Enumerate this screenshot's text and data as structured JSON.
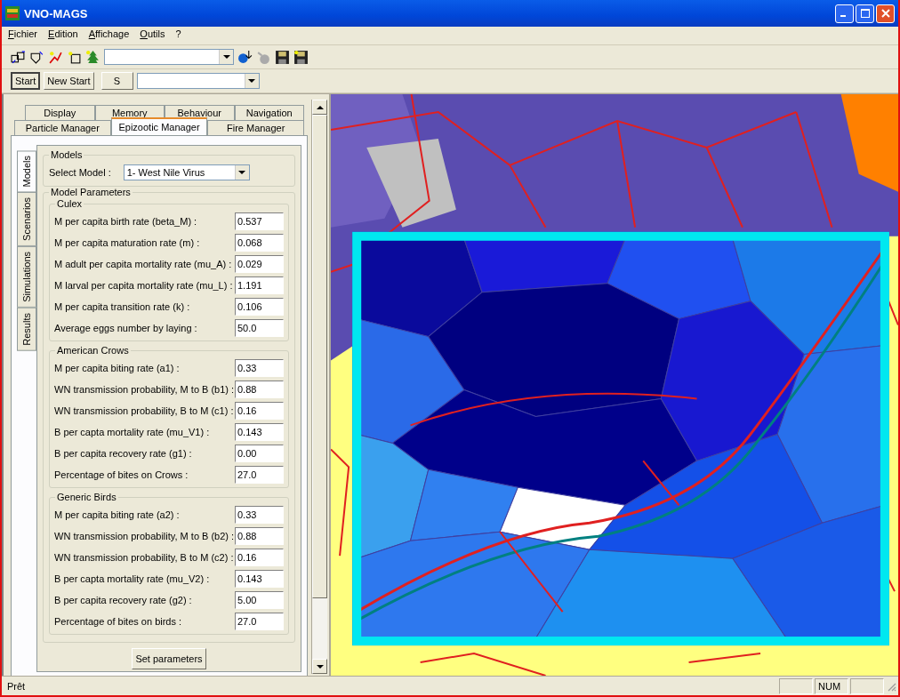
{
  "window": {
    "title": "VNO-MAGS"
  },
  "menu": [
    "Fichier",
    "Edition",
    "Affichage",
    "Outils",
    "?"
  ],
  "run_bar": {
    "buttons": [
      {
        "label": "Start",
        "pressed": true
      },
      {
        "label": "New Start",
        "pressed": false
      },
      {
        "label": "S",
        "pressed": false
      }
    ]
  },
  "top_tabs": [
    [
      {
        "label": "Display",
        "selected": false
      },
      {
        "label": "Memory",
        "selected": false
      },
      {
        "label": "Behaviour",
        "selected": false
      },
      {
        "label": "Navigation",
        "selected": false
      }
    ],
    [
      {
        "label": "Particle Manager",
        "selected": false
      },
      {
        "label": "Epizootic Manager",
        "selected": true
      },
      {
        "label": "Fire Manager",
        "selected": false
      }
    ]
  ],
  "side_tabs": [
    {
      "label": "Models",
      "selected": true
    },
    {
      "label": "Scenarios",
      "selected": false
    },
    {
      "label": "Simulations",
      "selected": false
    },
    {
      "label": "Results",
      "selected": false
    }
  ],
  "models": {
    "title": "Models",
    "select_label": "Select Model :",
    "select_value": "1- West Nile Virus"
  },
  "parameters": {
    "title": "Model Parameters",
    "groups": [
      {
        "title": "Culex",
        "rows": [
          {
            "label": "M per capita birth rate (beta_M) :",
            "value": "0.537"
          },
          {
            "label": "M per capita maturation rate (m) :",
            "value": "0.068"
          },
          {
            "label": "M adult per capita mortality rate (mu_A) :",
            "value": "0.029"
          },
          {
            "label": "M larval per capita mortality rate (mu_L) :",
            "value": "1.191"
          },
          {
            "label": "M per capita transition rate (k) :",
            "value": "0.106"
          },
          {
            "label": "Average eggs number by laying :",
            "value": "50.0"
          }
        ]
      },
      {
        "title": "American Crows",
        "rows": [
          {
            "label": "M per capita biting rate (a1) :",
            "value": "0.33"
          },
          {
            "label": "WN transmission probability, M to B (b1) :",
            "value": "0.88"
          },
          {
            "label": "WN transmission probability, B to M (c1) :",
            "value": "0.16"
          },
          {
            "label": "B per capta mortality rate (mu_V1) :",
            "value": "0.143"
          },
          {
            "label": "B per capita recovery rate (g1) :",
            "value": "0.00"
          },
          {
            "label": "Percentage of bites on Crows :",
            "value": "27.0"
          }
        ]
      },
      {
        "title": "Generic Birds",
        "rows": [
          {
            "label": "M per capita biting rate (a2) :",
            "value": "0.33"
          },
          {
            "label": "WN transmission probability, M to B (b2) :",
            "value": "0.88"
          },
          {
            "label": "WN transmission probability, B to M (c2) :",
            "value": "0.16"
          },
          {
            "label": "B per capta mortality rate (mu_V2) :",
            "value": "0.143"
          },
          {
            "label": "B per capita recovery rate (g2) :",
            "value": "5.00"
          },
          {
            "label": "Percentage of bites on birds :",
            "value": "27.0"
          }
        ]
      }
    ],
    "button": "Set parameters"
  },
  "status_bar": {
    "text": "Prêt",
    "indicators": [
      "NUM"
    ]
  }
}
